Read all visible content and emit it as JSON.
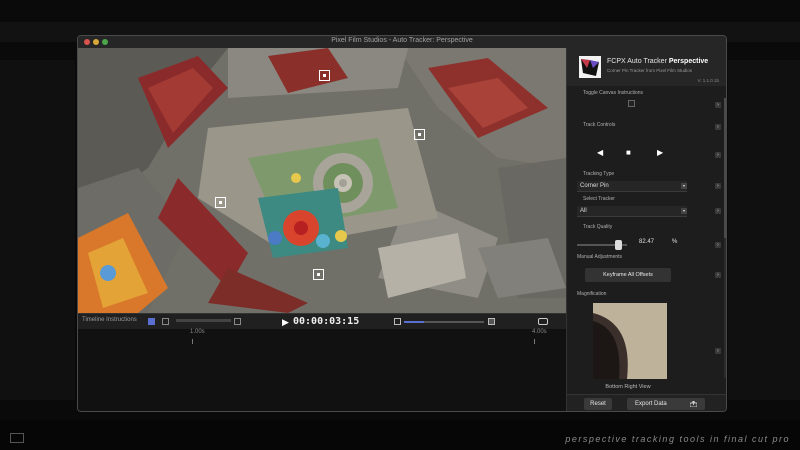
{
  "window": {
    "title": "Pixel Film Studios - Auto Tracker: Perspective"
  },
  "viewer": {
    "timeline_instructions_label": "Timeline Instructions",
    "play_icon": "play-icon",
    "timecode": "00:00:03:15",
    "scrub_progress": 0.25
  },
  "timeline": {
    "start_label": "1.00s",
    "end_label": "4.00s"
  },
  "plugin": {
    "title_prefix": "FCPX Auto Tracker",
    "title_bold": "Perspective",
    "subtitle": "Corner Pin Tracker from Pixel Film Studios",
    "version": "V. 1.1.0.1b",
    "toggle_canvas_label": "Toggle Canvas Instructions",
    "track_controls_label": "Track Controls",
    "tracking_type_label": "Tracking Type",
    "tracking_type_value": "Corner Pin",
    "select_tracker_label": "Select Tracker",
    "select_tracker_value": "All",
    "track_quality_label": "Track Quality",
    "track_quality_value": "82.47",
    "track_quality_unit": "%",
    "track_quality_level": 0.8247,
    "manual_adjustments_label": "Manual Adjustments",
    "keyframe_button": "Keyframe All Offsets",
    "magnification_label": "Magnification",
    "magnification_caption": "Bottom Right View",
    "reset_button": "Reset",
    "export_button": "Export Data"
  },
  "caption": "perspective tracking tools in final cut pro",
  "colors": {
    "accent": "#5a6fd0",
    "building_red": "#8a2a2a"
  }
}
